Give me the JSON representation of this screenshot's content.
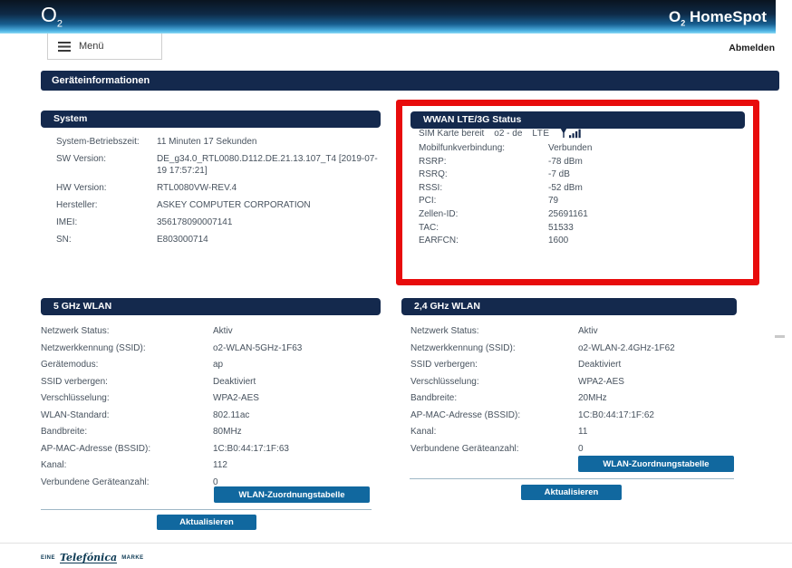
{
  "colors": {
    "navy": "#14294d",
    "button_blue": "#11689f",
    "highlight_red": "#e80c0c",
    "text": "#47525e"
  },
  "header": {
    "logo_main": "O",
    "logo_sub": "2",
    "product_main": "O",
    "product_sub": "2",
    "product_name": "HomeSpot"
  },
  "menu": {
    "label": "Menü"
  },
  "logout_label": "Abmelden",
  "page_title": "Geräteinformationen",
  "sections": {
    "system": {
      "title": "System",
      "rows": [
        {
          "label": "System-Betriebszeit:",
          "value": "11 Minuten 17 Sekunden"
        },
        {
          "label": "SW Version:",
          "value": "DE_g34.0_RTL0080.D112.DE.21.13.107_T4 [2019-07-19 17:57:21]"
        },
        {
          "label": "HW Version:",
          "value": "RTL0080VW-REV.4"
        },
        {
          "label": "Hersteller:",
          "value": "ASKEY COMPUTER CORPORATION"
        },
        {
          "label": "IMEI:",
          "value": "356178090007141"
        },
        {
          "label": "SN:",
          "value": "E803000714"
        }
      ]
    },
    "wwan": {
      "title": "WWAN LTE/3G Status",
      "sim_status": "SIM Karte bereit",
      "operator": "o2 - de",
      "network_type": "LTE",
      "signal_icon": "signal-strength-icon",
      "rows": [
        {
          "label": "Mobilfunkverbindung:",
          "value": "Verbunden"
        },
        {
          "label": "RSRP:",
          "value": "-78 dBm"
        },
        {
          "label": "RSRQ:",
          "value": "-7 dB"
        },
        {
          "label": "RSSI:",
          "value": "-52 dBm"
        },
        {
          "label": "PCI:",
          "value": "79"
        },
        {
          "label": "Zellen-ID:",
          "value": "25691161"
        },
        {
          "label": "TAC:",
          "value": "51533"
        },
        {
          "label": "EARFCN:",
          "value": "1600"
        }
      ]
    },
    "wlan5": {
      "title": "5 GHz WLAN",
      "rows": [
        {
          "label": "Netzwerk Status:",
          "value": "Aktiv"
        },
        {
          "label": "Netzwerkkennung (SSID):",
          "value": "o2-WLAN-5GHz-1F63"
        },
        {
          "label": "Gerätemodus:",
          "value": "ap"
        },
        {
          "label": "SSID verbergen:",
          "value": "Deaktiviert"
        },
        {
          "label": "Verschlüsselung:",
          "value": "WPA2-AES"
        },
        {
          "label": "WLAN-Standard:",
          "value": "802.11ac"
        },
        {
          "label": "Bandbreite:",
          "value": "80MHz"
        },
        {
          "label": "AP-MAC-Adresse (BSSID):",
          "value": "1C:B0:44:17:1F:63"
        },
        {
          "label": "Kanal:",
          "value": "112"
        },
        {
          "label": "Verbundene Geräteanzahl:",
          "value": "0"
        }
      ]
    },
    "wlan24": {
      "title": "2,4 GHz WLAN",
      "rows": [
        {
          "label": "Netzwerk Status:",
          "value": "Aktiv"
        },
        {
          "label": "Netzwerkkennung (SSID):",
          "value": "o2-WLAN-2.4GHz-1F62"
        },
        {
          "label": "SSID verbergen:",
          "value": "Deaktiviert"
        },
        {
          "label": "Verschlüsselung:",
          "value": "WPA2-AES"
        },
        {
          "label": "Bandbreite:",
          "value": "20MHz"
        },
        {
          "label": "AP-MAC-Adresse (BSSID):",
          "value": "1C:B0:44:17:1F:62"
        },
        {
          "label": "Kanal:",
          "value": "11"
        },
        {
          "label": "Verbundene Geräteanzahl:",
          "value": "0"
        }
      ]
    }
  },
  "buttons": {
    "wlan_table": "WLAN-Zuordnungstabelle",
    "refresh": "Aktualisieren"
  },
  "footer": {
    "pre": "EINE",
    "brand": "Telefónica",
    "post": "MARKE"
  }
}
